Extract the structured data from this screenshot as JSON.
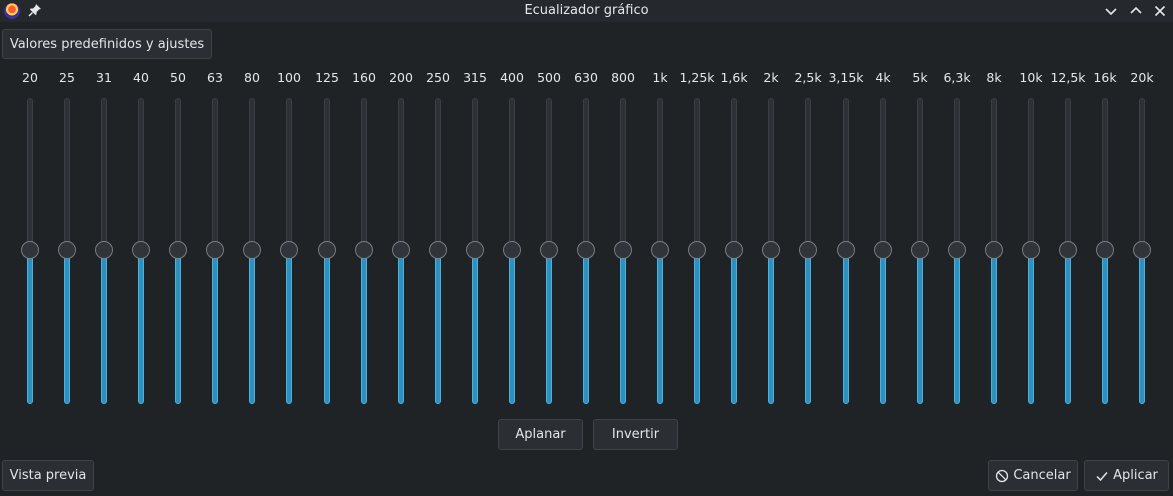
{
  "window": {
    "title": "Ecualizador gráfico"
  },
  "toolbar": {
    "presets_label": "Valores predefinidos y ajustes"
  },
  "bands": [
    {
      "label": "20",
      "gain": 0
    },
    {
      "label": "25",
      "gain": 0
    },
    {
      "label": "31",
      "gain": 0
    },
    {
      "label": "40",
      "gain": 0
    },
    {
      "label": "50",
      "gain": 0
    },
    {
      "label": "63",
      "gain": 0
    },
    {
      "label": "80",
      "gain": 0
    },
    {
      "label": "100",
      "gain": 0
    },
    {
      "label": "125",
      "gain": 0
    },
    {
      "label": "160",
      "gain": 0
    },
    {
      "label": "200",
      "gain": 0
    },
    {
      "label": "250",
      "gain": 0
    },
    {
      "label": "315",
      "gain": 0
    },
    {
      "label": "400",
      "gain": 0
    },
    {
      "label": "500",
      "gain": 0
    },
    {
      "label": "630",
      "gain": 0
    },
    {
      "label": "800",
      "gain": 0
    },
    {
      "label": "1k",
      "gain": 0
    },
    {
      "label": "1,25k",
      "gain": 0
    },
    {
      "label": "1,6k",
      "gain": 0
    },
    {
      "label": "2k",
      "gain": 0
    },
    {
      "label": "2,5k",
      "gain": 0
    },
    {
      "label": "3,15k",
      "gain": 0
    },
    {
      "label": "4k",
      "gain": 0
    },
    {
      "label": "5k",
      "gain": 0
    },
    {
      "label": "6,3k",
      "gain": 0
    },
    {
      "label": "8k",
      "gain": 0
    },
    {
      "label": "10k",
      "gain": 0
    },
    {
      "label": "12,5k",
      "gain": 0
    },
    {
      "label": "16k",
      "gain": 0
    },
    {
      "label": "20k",
      "gain": 0
    }
  ],
  "actions": {
    "flatten_label": "Aplanar",
    "invert_label": "Invertir"
  },
  "footer": {
    "preview_label": "Vista previa",
    "cancel_label": "Cancelar",
    "apply_label": "Aplicar"
  },
  "colors": {
    "accent": "#2f8fbd",
    "background": "#202326"
  }
}
